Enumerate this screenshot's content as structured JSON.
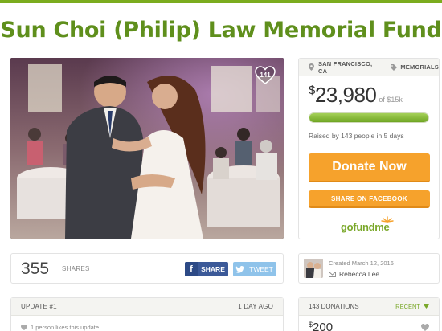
{
  "campaign": {
    "title": "Sun Choi (Philip) Law Memorial Fund",
    "photo_likes": "141",
    "location": "SAN FRANCISCO, CA",
    "category": "MEMORIALS"
  },
  "funding": {
    "currency": "$",
    "amount": "23,980",
    "goal": "of $15k",
    "progress_percent": 100,
    "raised_text": "Raised by 143 people in 5 days"
  },
  "actions": {
    "donate_label": "Donate Now",
    "share_facebook_label": "SHARE ON FACEBOOK"
  },
  "brand": {
    "logo_go": "go",
    "logo_fund": "fund",
    "logo_me": "me"
  },
  "shares": {
    "count": "355",
    "label": "SHARES",
    "fb_label": "SHARE",
    "fb_icon": "f",
    "tweet_label": "TWEET"
  },
  "organizer": {
    "created": "Created March 12, 2016",
    "name": "Rebecca Lee"
  },
  "update": {
    "title": "UPDATE #1",
    "age": "1 DAY AGO",
    "likes_text": "1 person likes this update"
  },
  "donations": {
    "count_label": "143 DONATIONS",
    "sort_label": "RECENT",
    "first_currency": "$",
    "first_amount": "200"
  },
  "colors": {
    "accent_green": "#7bac1e",
    "title_green": "#5f8f1c",
    "donate_orange": "#f6a22c",
    "facebook_blue": "#3b5998",
    "twitter_blue": "#8fc3ea"
  },
  "icons": [
    "heart-icon",
    "location-pin-icon",
    "tag-icon",
    "facebook-icon",
    "twitter-icon",
    "mail-icon",
    "chevron-down-icon"
  ]
}
